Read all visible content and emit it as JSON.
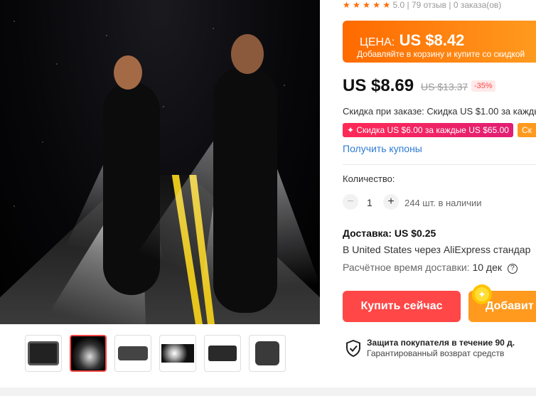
{
  "top": {
    "rating_stars": "★ ★ ★ ★ ★",
    "rating_text": "5.0",
    "orders_text": "| 79 отзыв | 0 заказа(ов)"
  },
  "thumbnails": [
    {
      "name": "device-thumb-1"
    },
    {
      "name": "runners-thumb"
    },
    {
      "name": "device-thumb-3"
    },
    {
      "name": "light-thumb"
    },
    {
      "name": "band-thumb"
    },
    {
      "name": "parts-thumb"
    }
  ],
  "banner": {
    "label": "ЦЕНА:",
    "price": "US $8.42",
    "subtitle": "Добавляйте в корзину и купите со скидкой"
  },
  "price": {
    "current": "US $8.69",
    "old": "US $13.37",
    "percent": "-35%"
  },
  "discount": {
    "line": "Скидка при заказе: Скидка US $1.00 за каждые",
    "chip1": "✦ Скидка US $6.00 за каждые US $65.00",
    "chip2": "Ск",
    "coupons": "Получить купоны"
  },
  "quantity": {
    "label": "Количество:",
    "value": "1",
    "stock": "244 шт. в наличии",
    "minus": "−",
    "plus": "+"
  },
  "shipping": {
    "title": "Доставка: US $0.25",
    "via": "В United States через AliExpress стандар",
    "time_label": "Расчётное время доставки:",
    "time_value": "10 дек",
    "help": "?"
  },
  "buttons": {
    "buy": "Купить сейчас",
    "cart": "Добавит"
  },
  "protection": {
    "title": "Защита покупателя в течение 90 д.",
    "subtitle": "Гарантированный возврат средств"
  },
  "colors": {
    "accent": "#ff4747",
    "orange": "#ff9a1f",
    "link": "#2e7bd1"
  }
}
